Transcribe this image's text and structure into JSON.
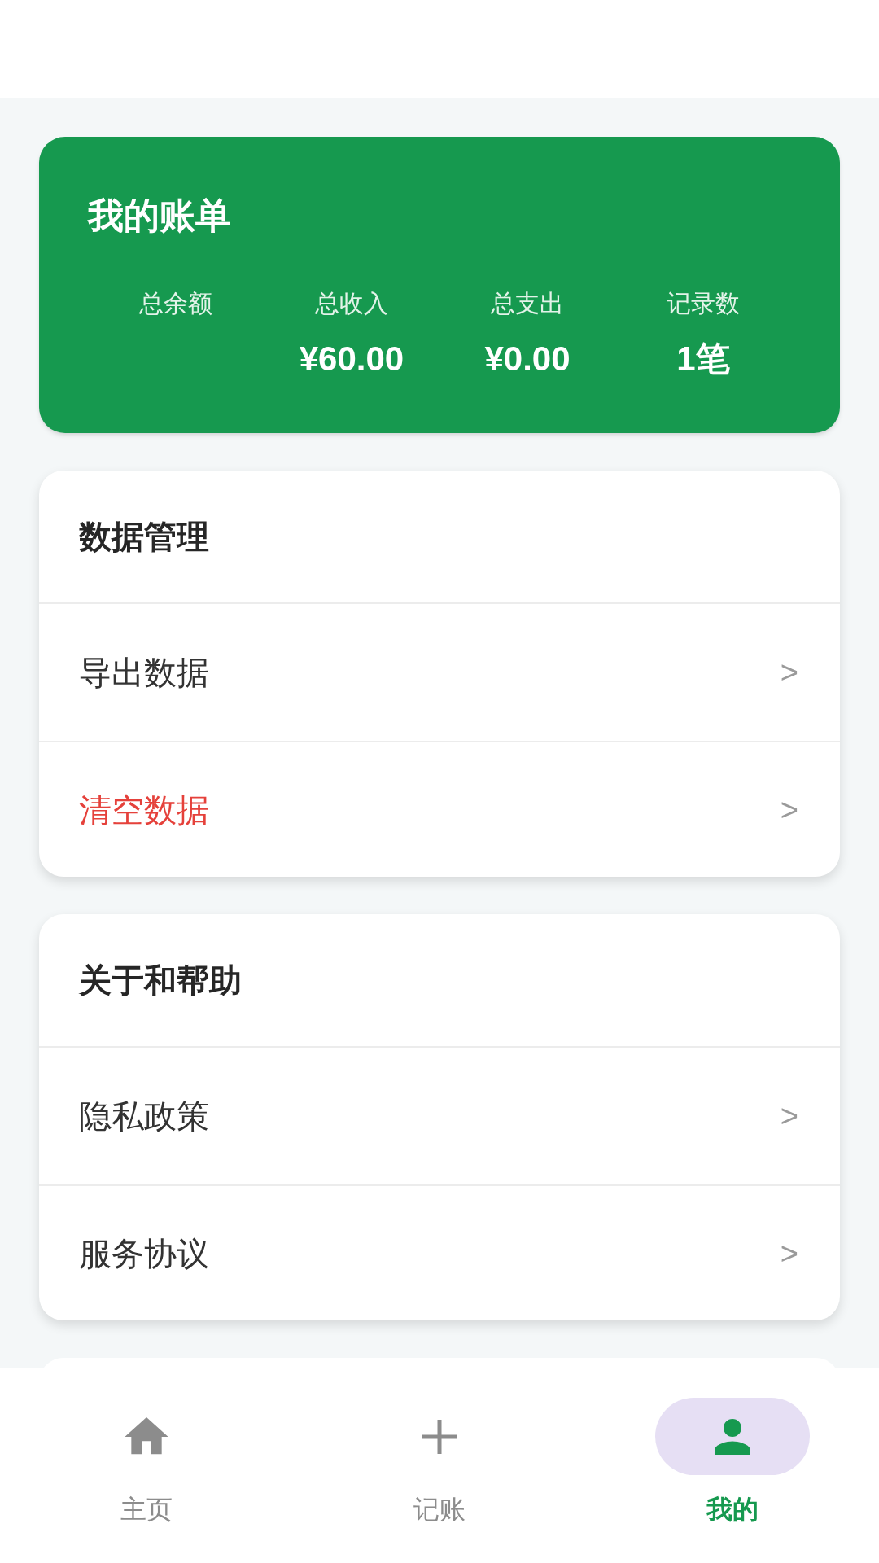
{
  "summary_card": {
    "title": "我的账单",
    "stats": [
      {
        "label": "总余额"
      },
      {
        "label": "总收入",
        "value": "¥60.00"
      },
      {
        "label": "总支出",
        "value": "¥0.00"
      },
      {
        "label": "记录数",
        "value": "1笔"
      }
    ]
  },
  "sections": [
    {
      "title": "数据管理",
      "items": [
        {
          "label": "导出数据",
          "kind": "normal",
          "arrow": ">"
        },
        {
          "label": "清空数据",
          "kind": "danger",
          "arrow": ">"
        }
      ]
    },
    {
      "title": "关于和帮助",
      "items": [
        {
          "label": "隐私政策",
          "kind": "normal",
          "arrow": ">"
        },
        {
          "label": "服务协议",
          "kind": "normal",
          "arrow": ">"
        }
      ]
    }
  ],
  "bottom_nav": {
    "tabs": [
      {
        "label": "主页",
        "kind": "home",
        "selected": false
      },
      {
        "label": "记账",
        "kind": "add",
        "selected": false
      },
      {
        "label": "我的",
        "kind": "profile",
        "selected": true
      }
    ]
  }
}
